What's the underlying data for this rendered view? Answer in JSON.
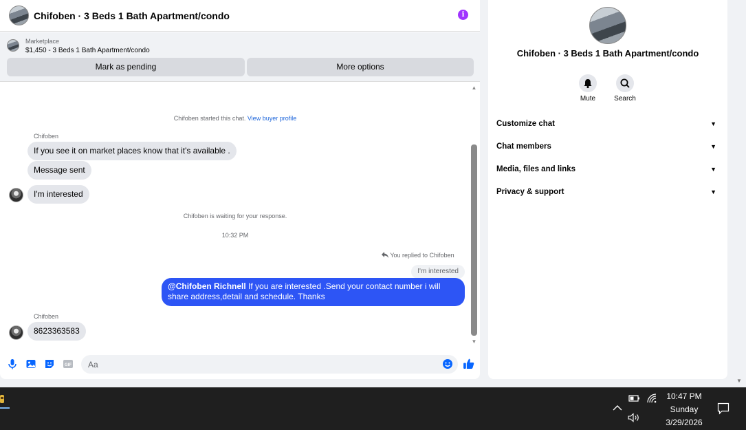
{
  "header": {
    "title": "Chifoben · 3 Beds 1 Bath Apartment/condo",
    "info_glyph": "i"
  },
  "listing": {
    "label": "Marketplace",
    "price_title": "$1,450 - 3 Beds 1 Bath Apartment/condo",
    "mark_pending_label": "Mark as pending",
    "more_options_label": "More options"
  },
  "conversation": {
    "started_text": "Chifoben started this chat.",
    "view_profile_label": "View buyer profile",
    "sender_name_1": "Chifoben",
    "msg_1": "If you see it on market places know that it's available .",
    "msg_2": "Message sent",
    "msg_3": "I'm interested",
    "waiting_text": "Chifoben is waiting for your response.",
    "timestamp": "10:32 PM",
    "replied_to_text": "You replied to Chifoben",
    "quoted_text": "I'm interested",
    "reply_mention": "@Chifoben Richnell",
    "reply_body": " If you are interested .Send your contact number i will share address,detail and schedule. Thanks",
    "sender_name_2": "Chifoben",
    "msg_4": "8623363583"
  },
  "composer": {
    "placeholder": "Aa"
  },
  "side_panel": {
    "title": "Chifoben · 3 Beds 1 Bath Apartment/condo",
    "mute_label": "Mute",
    "search_label": "Search",
    "rows": [
      "Customize chat",
      "Chat members",
      "Media, files and links",
      "Privacy & support"
    ]
  },
  "taskbar": {
    "time": "10:47 PM",
    "day": "Sunday",
    "date": "3/29/2026"
  },
  "colors": {
    "accent_blue": "#2d55f5",
    "link_blue": "#1b64da",
    "info_purple": "#a033ff"
  },
  "icons": [
    "info-icon",
    "mic-icon",
    "image-icon",
    "sticker-icon",
    "gif-icon",
    "emoji-icon",
    "like-icon",
    "bell-icon",
    "search-icon",
    "chevron-down-icon",
    "reply-icon",
    "battery-icon",
    "wifi-icon",
    "volume-icon",
    "chevron-up-icon",
    "notification-icon"
  ]
}
